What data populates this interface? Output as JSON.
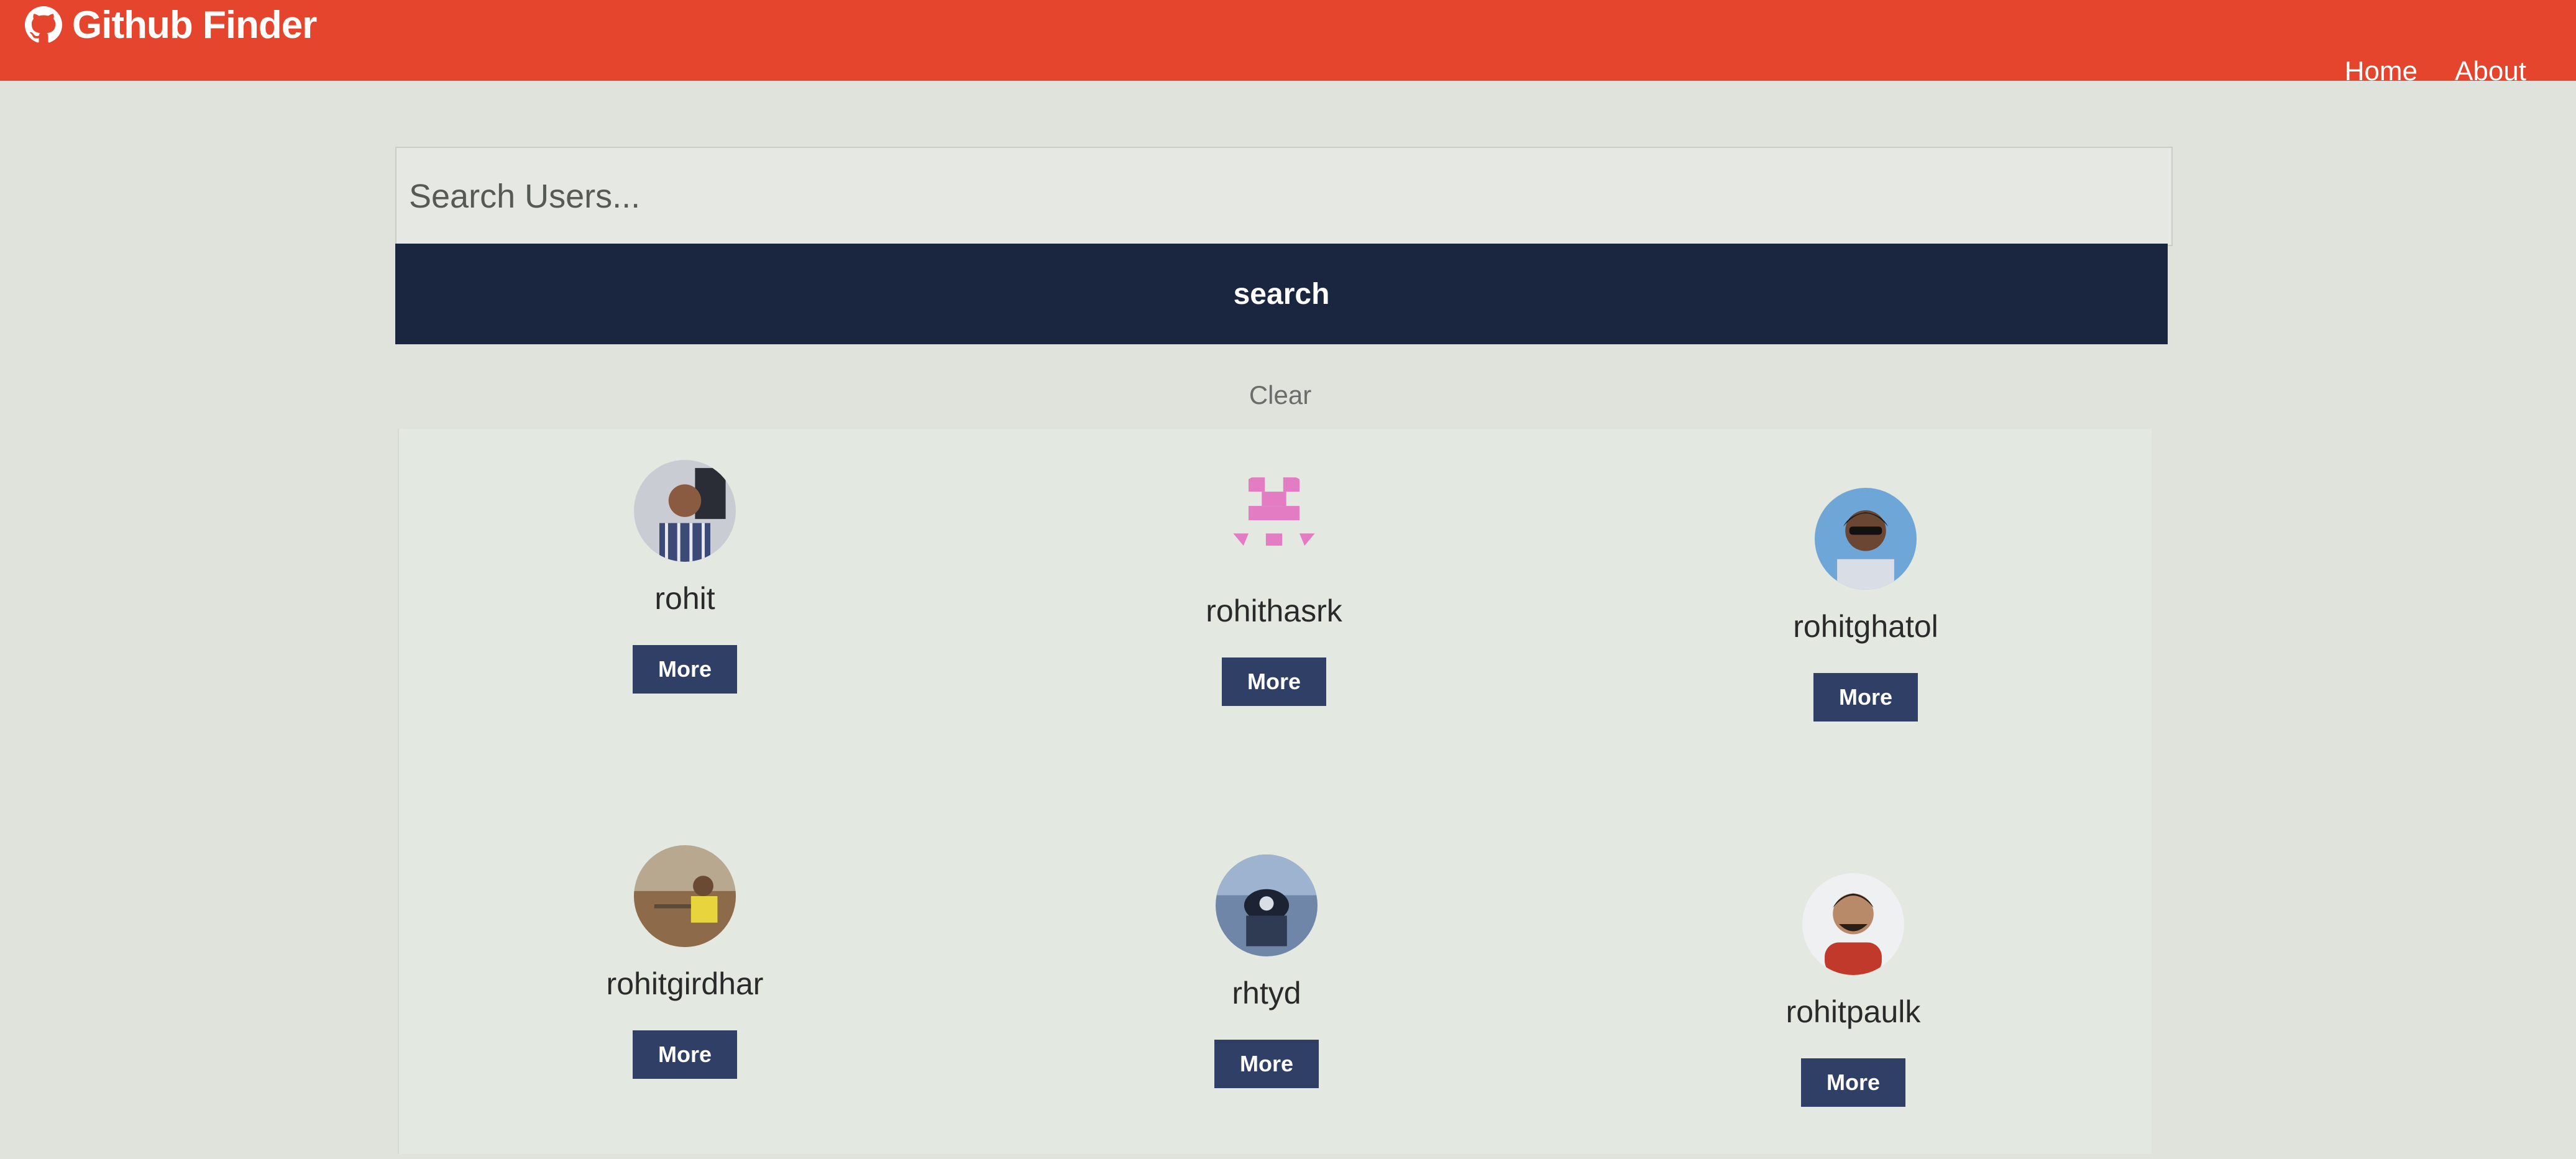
{
  "navbar": {
    "brand": "Github Finder",
    "brand_icon": "github-icon",
    "links": [
      {
        "label": "Home"
      },
      {
        "label": "About"
      }
    ]
  },
  "search": {
    "placeholder": "Search Users...",
    "value": "",
    "button_label": "search",
    "clear_label": "Clear"
  },
  "users": [
    {
      "login": "rohit",
      "more_label": "More"
    },
    {
      "login": "rohithasrk",
      "more_label": "More"
    },
    {
      "login": "rohitghatol",
      "more_label": "More"
    },
    {
      "login": "rohitgirdhar",
      "more_label": "More"
    },
    {
      "login": "rhtyd",
      "more_label": "More"
    },
    {
      "login": "rohitpaulk",
      "more_label": "More"
    }
  ],
  "colors": {
    "navbar": "#e5452c",
    "search_button": "#1a2540",
    "more_button": "#2f3f66"
  }
}
